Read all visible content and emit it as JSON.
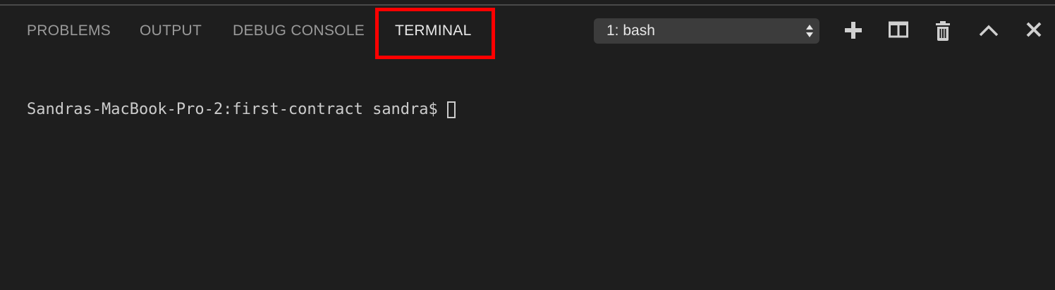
{
  "panel": {
    "tabs": [
      {
        "label": "PROBLEMS"
      },
      {
        "label": "OUTPUT"
      },
      {
        "label": "DEBUG CONSOLE"
      },
      {
        "label": "TERMINAL",
        "active": true
      }
    ],
    "terminal_select": {
      "value": "1: bash"
    },
    "actions": [
      {
        "icon": "plus-icon"
      },
      {
        "icon": "split-icon"
      },
      {
        "icon": "trash-icon"
      },
      {
        "icon": "chevron-up-icon"
      },
      {
        "icon": "close-icon"
      }
    ]
  },
  "terminal": {
    "prompt": "Sandras-MacBook-Pro-2:first-contract sandra$"
  },
  "colors": {
    "background": "#1e1e1e",
    "highlight": "#ff0000",
    "active_tab": "#e8e8e8",
    "inactive_tab": "#9a9a9a"
  }
}
